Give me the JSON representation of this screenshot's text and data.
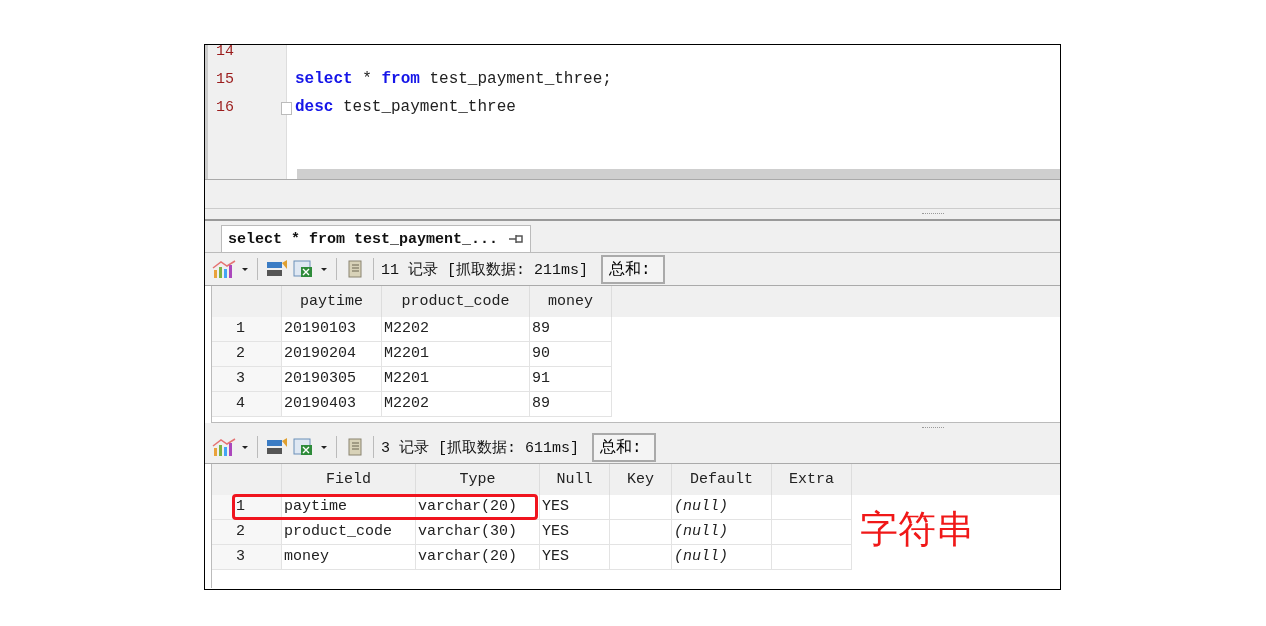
{
  "editor": {
    "lines": [
      {
        "number": "14",
        "fold": false
      },
      {
        "number": "15",
        "fold": false,
        "tokens": [
          {
            "kind": "keyword",
            "text": "select"
          },
          {
            "kind": "plain",
            "text": " * "
          },
          {
            "kind": "keyword",
            "text": "from"
          },
          {
            "kind": "plain",
            "text": " test_payment_three;"
          }
        ]
      },
      {
        "number": "16",
        "fold": true,
        "tokens": [
          {
            "kind": "keyword",
            "text": "desc"
          },
          {
            "kind": "plain",
            "text": " test_payment_three"
          }
        ]
      }
    ]
  },
  "result_tabs": [
    {
      "label": "select * from test_payment_...",
      "selected": true
    }
  ],
  "panels": [
    {
      "status": "11 记录 [抓取数据: 211ms]",
      "sum_label": "总和:",
      "columns": [
        {},
        {
          "label": "paytime"
        },
        {
          "label": "product_code"
        },
        {
          "label": "money"
        }
      ],
      "rows": [
        {
          "cells": [
            "1",
            "20190103",
            "M2202",
            "89"
          ]
        },
        {
          "cells": [
            "2",
            "20190204",
            "M2201",
            "90"
          ]
        },
        {
          "cells": [
            "3",
            "20190305",
            "M2201",
            "91"
          ]
        },
        {
          "cells": [
            "4",
            "20190403",
            "M2202",
            "89"
          ]
        }
      ]
    },
    {
      "status": "3 记录 [抓取数据: 611ms]",
      "sum_label": "总和:",
      "columns": [
        {},
        {
          "label": "Field"
        },
        {
          "label": "Type"
        },
        {
          "label": "Null"
        },
        {
          "label": "Key"
        },
        {
          "label": "Default",
          "italic": true
        },
        {
          "label": "Extra"
        }
      ],
      "rows": [
        {
          "cells": [
            "1",
            "paytime",
            "varchar(20)",
            "YES",
            null,
            "(null)",
            null
          ],
          "highlighted": true
        },
        {
          "cells": [
            "2",
            "product_code",
            "varchar(30)",
            "YES",
            null,
            "(null)",
            null
          ],
          "highlighted": false
        },
        {
          "cells": [
            "3",
            "money",
            "varchar(20)",
            "YES",
            null,
            "(null)",
            null
          ],
          "highlighted": false
        }
      ],
      "annotation": "字符串"
    }
  ]
}
